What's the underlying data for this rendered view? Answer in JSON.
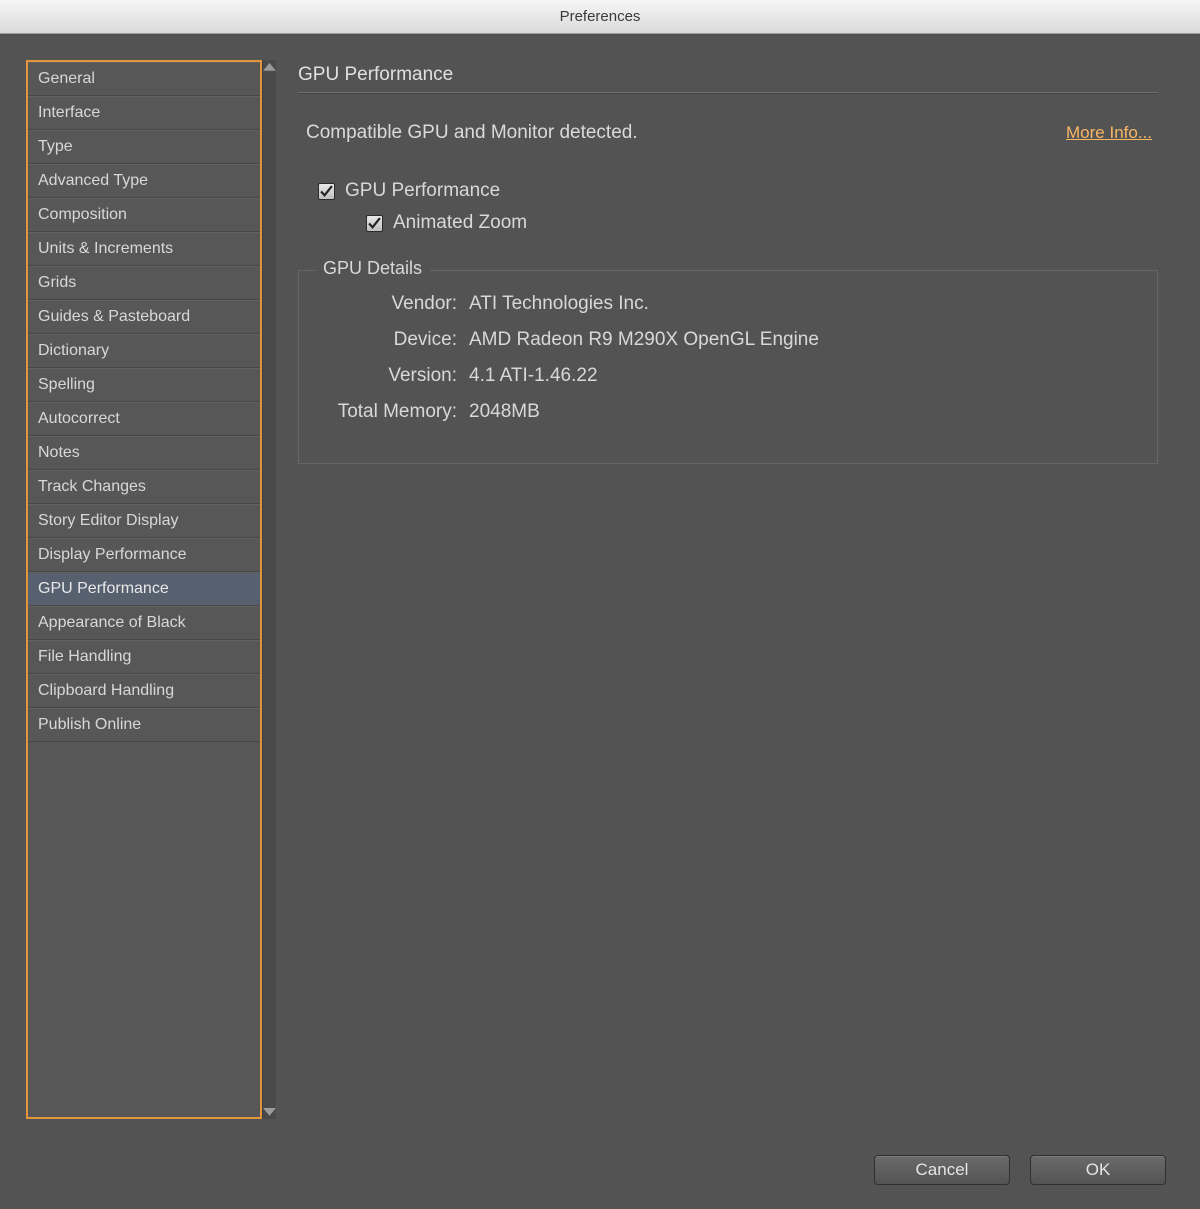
{
  "window": {
    "title": "Preferences"
  },
  "sidebar": {
    "items": [
      {
        "label": "General"
      },
      {
        "label": "Interface"
      },
      {
        "label": "Type"
      },
      {
        "label": "Advanced Type"
      },
      {
        "label": "Composition"
      },
      {
        "label": "Units & Increments"
      },
      {
        "label": "Grids"
      },
      {
        "label": "Guides & Pasteboard"
      },
      {
        "label": "Dictionary"
      },
      {
        "label": "Spelling"
      },
      {
        "label": "Autocorrect"
      },
      {
        "label": "Notes"
      },
      {
        "label": "Track Changes"
      },
      {
        "label": "Story Editor Display"
      },
      {
        "label": "Display Performance"
      },
      {
        "label": "GPU Performance"
      },
      {
        "label": "Appearance of Black"
      },
      {
        "label": "File Handling"
      },
      {
        "label": "Clipboard Handling"
      },
      {
        "label": "Publish Online"
      }
    ],
    "selected_index": 15
  },
  "panel": {
    "title": "GPU Performance",
    "compat_text": "Compatible GPU and Monitor detected.",
    "more_info": "More Info...",
    "check_gpu_perf": {
      "label": "GPU Performance",
      "checked": true
    },
    "check_anim_zoom": {
      "label": "Animated Zoom",
      "checked": true
    },
    "details": {
      "legend": "GPU Details",
      "rows": [
        {
          "label": "Vendor:",
          "value": "ATI Technologies Inc."
        },
        {
          "label": "Device:",
          "value": "AMD Radeon R9 M290X OpenGL Engine"
        },
        {
          "label": "Version:",
          "value": "4.1 ATI-1.46.22"
        },
        {
          "label": "Total Memory:",
          "value": "2048MB"
        }
      ]
    }
  },
  "buttons": {
    "cancel": "Cancel",
    "ok": "OK"
  }
}
